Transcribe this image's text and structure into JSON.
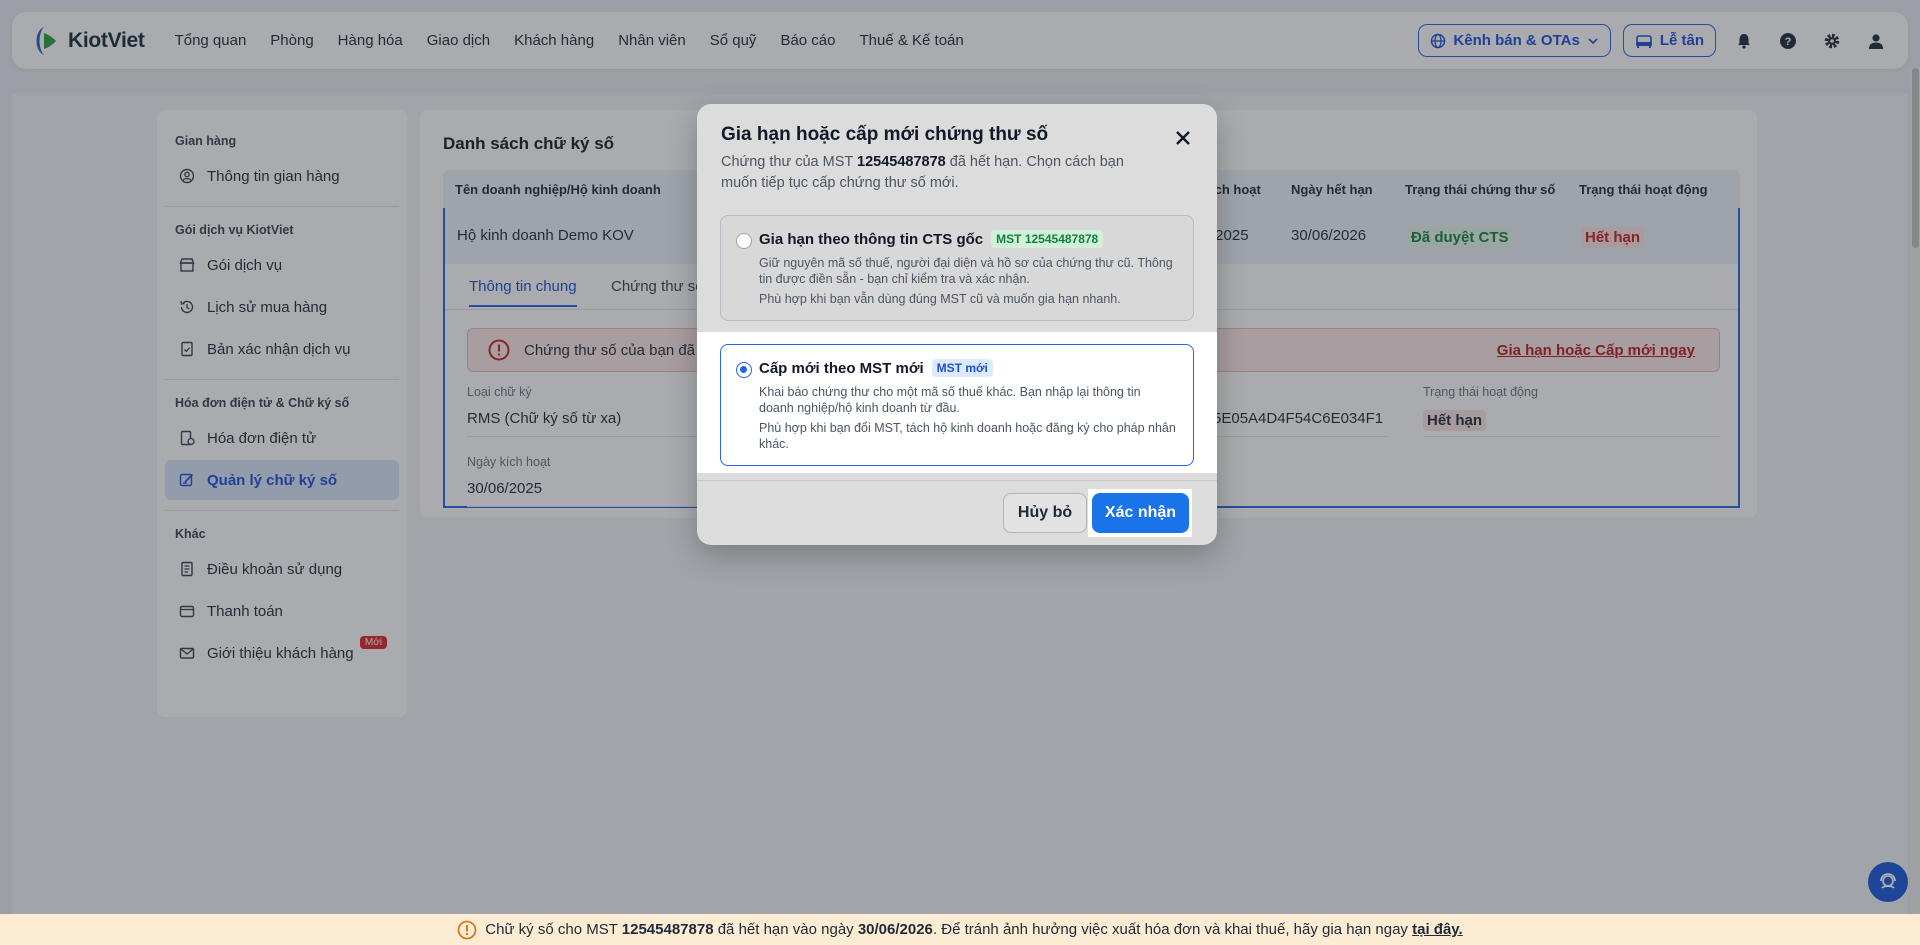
{
  "brand": {
    "name": "KiotViet"
  },
  "nav": [
    "Tổng quan",
    "Phòng",
    "Hàng hóa",
    "Giao dịch",
    "Khách hàng",
    "Nhân viên",
    "Sổ quỹ",
    "Báo cáo",
    "Thuế & Kế toán"
  ],
  "header": {
    "channel_label": "Kênh bán & OTAs",
    "frontdesk_label": "Lễ tân"
  },
  "sidebar": {
    "group1": "Gian hàng",
    "item_store_info": "Thông tin gian hàng",
    "group2": "Gói dịch vụ KiotViet",
    "item_service": "Gói dịch vụ",
    "item_history": "Lịch sử mua hàng",
    "item_confirm": "Bản xác nhận dịch vụ",
    "group3": "Hóa đơn điện tử & Chữ ký số",
    "item_einvoice": "Hóa đơn điện tử",
    "item_signature": "Quản lý chữ ký số",
    "group4": "Khác",
    "item_terms": "Điều khoản sử dụng",
    "item_payment": "Thanh toán",
    "item_referral": "Giới thiệu khách hàng",
    "badge_new": "Mới"
  },
  "main": {
    "title": "Danh sách chữ ký số",
    "col_company": "Tên doanh nghiệp/Hộ kinh doanh",
    "col_activated": "ích hoạt",
    "col_expiry": "Ngày hết hạn",
    "col_cert_status": "Trạng thái chứng thư số",
    "col_active_status": "Trạng thái hoạt động",
    "row_company": "Hộ kinh doanh Demo KOV",
    "row_activated": "/2025",
    "row_expiry": "30/06/2026",
    "row_cert_status": "Đã duyệt CTS",
    "row_active_status": "Hết hạn",
    "tab_general": "Thông tin chung",
    "tab_cert": "Chứng thư số",
    "alert_text": "Chứng thư số của bạn đã",
    "alert_link": "Gia hạn hoặc Cấp mới ngay",
    "label_type": "Loại chữ ký",
    "value_type": "RMS (Chữ ký số từ xa)",
    "label_activation": "Ngày kích hoạt",
    "value_activation": "30/06/2025",
    "value_serial": "5E05A4D4F54C6E034F1",
    "label_op_status": "Trạng thái hoạt động",
    "value_op_status": "Hết hạn"
  },
  "modal": {
    "title": "Gia hạn hoặc cấp mới chứng thư số",
    "desc_before": "Chứng thư của MST ",
    "desc_mst": "12545487878",
    "desc_after": " đã hết hạn. Chọn cách bạn muốn tiếp tục cấp chứng thư số mới.",
    "opt1_title": "Gia hạn theo thông tin CTS gốc",
    "opt1_badge": "MST 12545487878",
    "opt1_desc": "Giữ nguyên mã số thuế, người đại diện và hồ sơ của chứng thư cũ. Thông tin được điền sẵn - bạn chỉ kiểm tra và xác nhận.",
    "opt1_note": "Phù hợp khi bạn vẫn dùng đúng MST cũ và muốn gia hạn nhanh.",
    "opt2_title": "Cấp mới theo MST mới",
    "opt2_badge": "MST mới",
    "opt2_desc": "Khai báo chứng thư cho một mã số thuế khác. Bạn nhập lại thông tin doanh nghiệp/hộ kinh doanh từ đầu.",
    "opt2_note": "Phù hợp khi bạn đổi MST, tách hộ kinh doanh hoặc đăng ký cho pháp nhân khác.",
    "cancel": "Hủy bỏ",
    "confirm": "Xác nhận"
  },
  "banner": {
    "p1": "Chữ ký số cho MST ",
    "mst": "12545487878",
    "p2": " đã hết hạn vào ngày ",
    "date": "30/06/2026",
    "p3": ". Để tránh ảnh hưởng việc xuất hóa đơn và khai thuế, hãy gia hạn ngay ",
    "link": "tại đây."
  },
  "colors": {
    "primary": "#1a73e8",
    "accent": "#2563eb",
    "danger": "#c81e1e",
    "success": "#15803d"
  }
}
